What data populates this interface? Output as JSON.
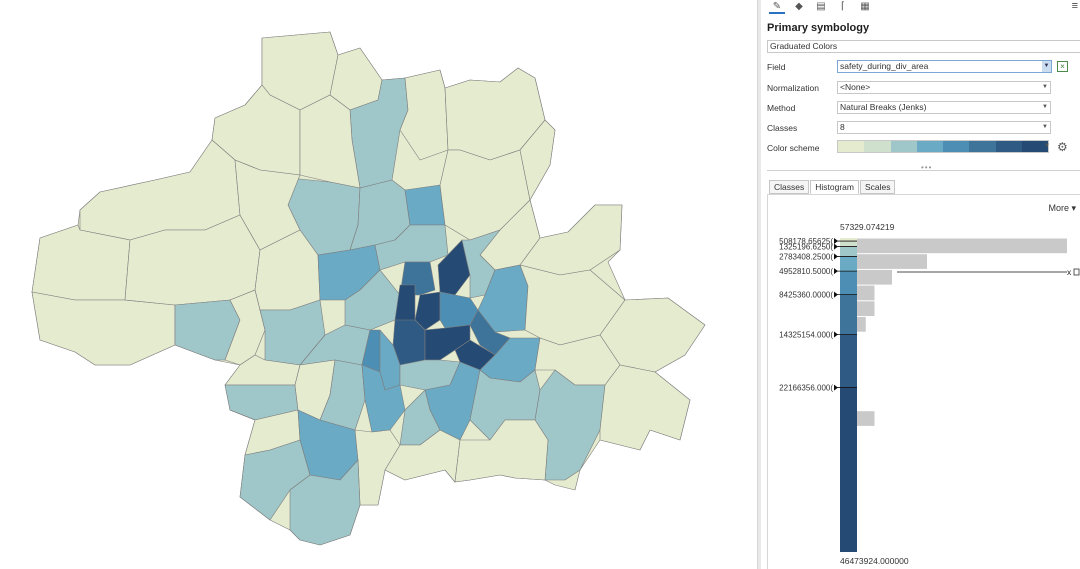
{
  "pane": {
    "title": "Primary symbology",
    "symbology_type": "Graduated Colors",
    "rows": {
      "field": {
        "label": "Field",
        "value": "safety_during_div_area"
      },
      "normalization": {
        "label": "Normalization",
        "value": "<None>"
      },
      "method": {
        "label": "Method",
        "value": "Natural Breaks (Jenks)"
      },
      "classes": {
        "label": "Classes",
        "value": "8"
      },
      "color_scheme": {
        "label": "Color scheme"
      }
    },
    "ramp_colors": [
      "#e5ebcf",
      "#cfe0cc",
      "#9fc6c8",
      "#6aaac5",
      "#4d8fb4",
      "#3e739a",
      "#2e5a84",
      "#254a73"
    ],
    "tabs": [
      "Classes",
      "Histogram",
      "Scales"
    ],
    "active_tab": "Histogram",
    "more_label": "More ▾",
    "toolbar_icons": [
      "paintbrush-icon",
      "shapes-icon",
      "layers-icon",
      "pin-icon",
      "grid-icon"
    ]
  },
  "histogram": {
    "min_label": "57329.074219",
    "max_label": "46473924.000000",
    "min": 57329.074219,
    "max": 46473924,
    "breaks": [
      "508178.65625(",
      "1325196.6250(",
      "2783408.2500(",
      "4952810.5000(",
      "8425360.0000(",
      "14325154.000(",
      "22166356.000("
    ],
    "break_values": [
      508178.65625,
      1325196.625,
      2783408.25,
      4952810.5,
      8425360,
      14325154,
      22166356
    ],
    "bin_counts": [
      24,
      8,
      4,
      2,
      2,
      1,
      0,
      0,
      0,
      0,
      0,
      2,
      0,
      0,
      0,
      0,
      0,
      0,
      0,
      0
    ],
    "class_colors": [
      "#e5ebcf",
      "#cfe0cc",
      "#9fc6c8",
      "#6aaac5",
      "#4d8fb4",
      "#3e739a",
      "#2e5a84",
      "#254a73"
    ],
    "marker_label": "x"
  },
  "map": {
    "background": "#ffffff",
    "district_colors": [
      "#e5ebcf",
      "#9fc6c8",
      "#6aaac5",
      "#4d8fb4",
      "#3e739a",
      "#2e5a84",
      "#254a73"
    ]
  }
}
